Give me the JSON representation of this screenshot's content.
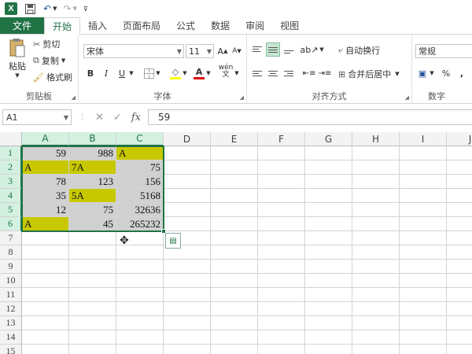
{
  "quick_access": {
    "logo": "X",
    "icons": [
      "excel-logo-icon",
      "save-icon",
      "undo-icon",
      "redo-icon",
      "customize-icon"
    ]
  },
  "tabs": [
    "文件",
    "开始",
    "插入",
    "页面布局",
    "公式",
    "数据",
    "审阅",
    "视图"
  ],
  "active_tab": "开始",
  "ribbon": {
    "clipboard": {
      "paste": "粘贴",
      "cut": "剪切",
      "copy": "复制",
      "format_painter": "格式刷",
      "label": "剪贴板"
    },
    "font": {
      "name": "宋体",
      "size": "11",
      "grow": "A",
      "shrink": "A",
      "bold": "B",
      "italic": "I",
      "underline": "U",
      "label": "字体"
    },
    "alignment": {
      "wrap_text": "自动换行",
      "merge_center": "合并后居中",
      "label": "对齐方式"
    },
    "number": {
      "format": "常规",
      "percent": "%",
      "comma": ",",
      "label": "数字"
    }
  },
  "formula_bar": {
    "cell_ref": "A1",
    "fx": "fx",
    "value": "59"
  },
  "columns": [
    "A",
    "B",
    "C",
    "D",
    "E",
    "F",
    "G",
    "H",
    "I",
    "J"
  ],
  "rows": [
    "1",
    "2",
    "3",
    "4",
    "5",
    "6",
    "7",
    "8",
    "9",
    "10",
    "11",
    "12",
    "13",
    "14",
    "15"
  ],
  "cells": [
    [
      {
        "v": "59",
        "t": "num",
        "bg": "gray"
      },
      {
        "v": "988",
        "t": "num",
        "bg": "gray"
      },
      {
        "v": "A",
        "t": "text",
        "bg": "yel"
      }
    ],
    [
      {
        "v": "A",
        "t": "text",
        "bg": "yel"
      },
      {
        "v": "7A",
        "t": "text",
        "bg": "yel"
      },
      {
        "v": "75",
        "t": "num",
        "bg": "gray"
      }
    ],
    [
      {
        "v": "78",
        "t": "num",
        "bg": "gray"
      },
      {
        "v": "123",
        "t": "num",
        "bg": "gray"
      },
      {
        "v": "156",
        "t": "num",
        "bg": "gray"
      }
    ],
    [
      {
        "v": "35",
        "t": "num",
        "bg": "gray"
      },
      {
        "v": "5A",
        "t": "text",
        "bg": "yel"
      },
      {
        "v": "5168",
        "t": "num",
        "bg": "gray"
      }
    ],
    [
      {
        "v": "12",
        "t": "num",
        "bg": "gray"
      },
      {
        "v": "75",
        "t": "num",
        "bg": "gray"
      },
      {
        "v": "32636",
        "t": "num",
        "bg": "gray"
      }
    ],
    [
      {
        "v": "A",
        "t": "text",
        "bg": "yel"
      },
      {
        "v": "45",
        "t": "num",
        "bg": "gray"
      },
      {
        "v": "265232",
        "t": "num",
        "bg": "gray"
      }
    ]
  ],
  "colors": {
    "accent": "#217346",
    "cell_gray": "#d0d0d0",
    "cell_yellow": "#c8c800"
  }
}
